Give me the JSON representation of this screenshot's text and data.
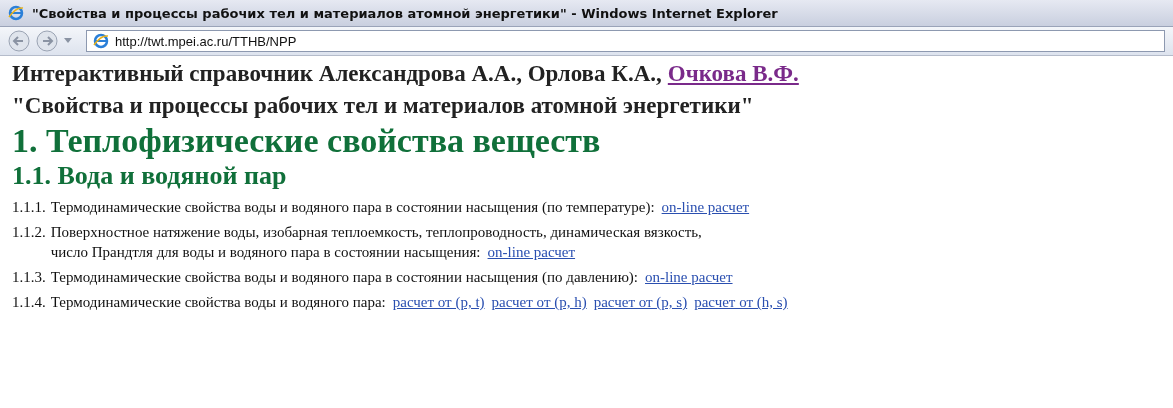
{
  "window": {
    "title": "\"Свойства и процессы рабочих тел и материалов атомной энергетики\" - Windows Internet Explorer"
  },
  "address_bar": {
    "url": "http://twt.mpei.ac.ru/TTHB/NPP"
  },
  "header": {
    "authors": "Интерактивный справочник Александрова А.А., Орлова К.А.,",
    "author_link": "Очкова В.Ф.",
    "subtitle": "\"Свойства и процессы рабочих тел и материалов атомной энергетики\""
  },
  "section": {
    "title": "1. Теплофизические свойства веществ",
    "subsection": "1.1. Вода и водяной пар"
  },
  "items": [
    {
      "number": "1.1.1.",
      "lines": [
        "Термодинамические свойства воды и водяного пара в состоянии насыщения (по температуре):"
      ],
      "links": [
        "on-line расчет"
      ]
    },
    {
      "number": "1.1.2.",
      "lines": [
        "Поверхностное натяжение воды, изобарная теплоемкость, теплопроводность, динамическая вязкость,",
        "число Прандтля для воды и водяного пара в состоянии насыщения:"
      ],
      "links": [
        "on-line расчет"
      ]
    },
    {
      "number": "1.1.3.",
      "lines": [
        "Термодинамические свойства воды и водяного пара в состоянии насыщения (по давлению):"
      ],
      "links": [
        "on-line расчет"
      ]
    },
    {
      "number": "1.1.4.",
      "lines": [
        "Термодинамические свойства воды и водяного пара:"
      ],
      "links": [
        "расчет от (p, t)",
        "расчет от (p, h)",
        "расчет от (p, s)",
        "расчет от (h, s)"
      ]
    }
  ]
}
